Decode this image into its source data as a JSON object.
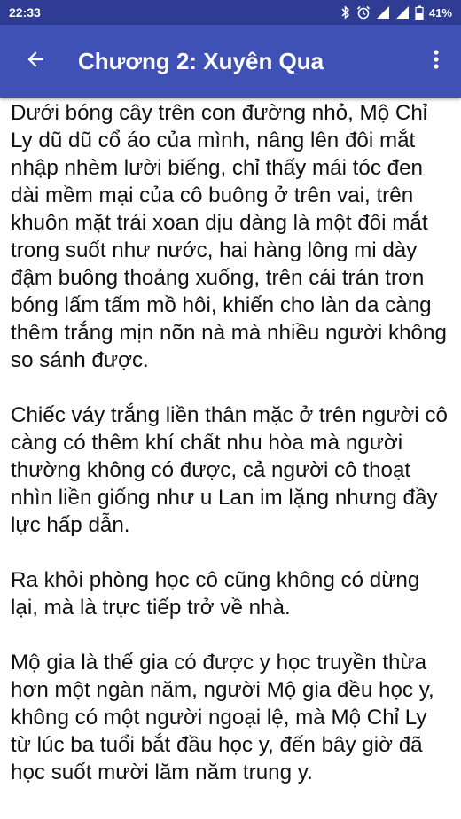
{
  "status_bar": {
    "time": "22:33",
    "battery": "41%",
    "icons": [
      "bluetooth-icon",
      "alarm-icon",
      "signal-icon",
      "signal-icon",
      "battery-icon"
    ]
  },
  "app_bar": {
    "title": "Chương 2: Xuyên Qua",
    "back_icon": "arrow-left-icon",
    "menu_icon": "more-vertical-icon",
    "color": "#3f51b5"
  },
  "content": {
    "paragraphs": [
      "Dưới bóng cây trên con đường nhỏ, Mộ Chỉ Ly dũ dũ cổ áo của mình, nâng lên đôi mắt nhập nhèm lười biếng, chỉ thấy mái tóc đen dài mềm mại của cô buông ở trên vai, trên khuôn mặt trái xoan dịu dàng là một đôi mắt trong suốt như nước, hai hàng lông mi dày đậm buông thoảng xuống, trên cái trán trơn bóng lấm tấm mồ hôi, khiến cho làn da càng thêm trắng mịn nõn nà mà nhiều người không so sánh được.",
      "Chiếc váy trắng liền thân mặc ở trên người cô càng có thêm khí chất nhu hòa mà người thường không có được, cả người cô thoạt nhìn liền giống như u Lan im lặng nhưng đầy lực hấp dẫn.",
      "Ra khỏi phòng học cô cũng không có dừng lại, mà là trực tiếp trở về nhà.",
      "Mộ gia là thế gia có được y học truyền thừa hơn một ngàn năm, người Mộ gia đều học y, không có một người ngoại lệ, mà Mộ Chỉ Ly từ lúc ba tuổi bắt đầu học y, đến bây giờ đã học suốt mười lăm năm trung y."
    ]
  }
}
